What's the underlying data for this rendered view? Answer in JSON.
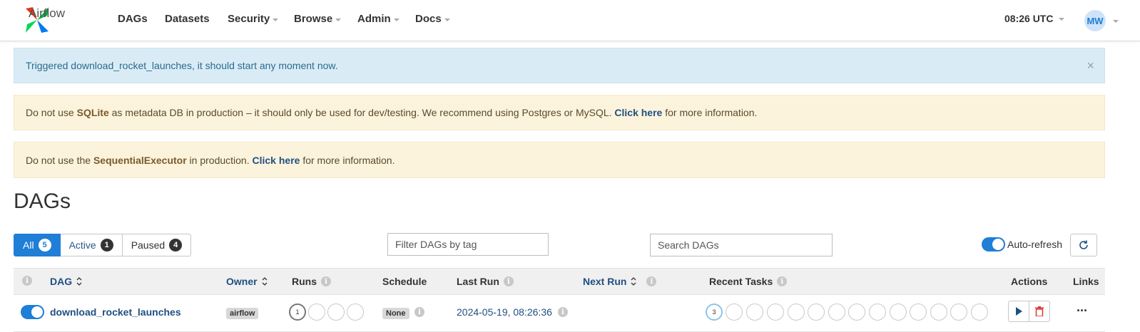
{
  "nav": {
    "brand": "Airflow",
    "items": [
      {
        "label": "DAGs"
      },
      {
        "label": "Datasets"
      },
      {
        "label": "Security"
      },
      {
        "label": "Browse"
      },
      {
        "label": "Admin"
      },
      {
        "label": "Docs"
      }
    ],
    "clock": "08:26 UTC",
    "user_initials": "MW"
  },
  "alerts": {
    "info": "Triggered download_rocket_launches, it should start any moment now.",
    "close": "×",
    "sqlite": {
      "pre": "Do not use ",
      "bold": "SQLite",
      "mid": " as metadata DB in production – it should only be used for dev/testing. We recommend using Postgres or MySQL. ",
      "link": "Click here",
      "post": " for more information."
    },
    "executor": {
      "pre": "Do not use the ",
      "bold": "SequentialExecutor",
      "mid": " in production. ",
      "link": "Click here",
      "post": " for more information."
    }
  },
  "page_title": "DAGs",
  "filters": [
    {
      "label": "All",
      "count": "5"
    },
    {
      "label": "Active",
      "count": "1"
    },
    {
      "label": "Paused",
      "count": "4"
    }
  ],
  "tag_filter": {
    "placeholder": "Filter DAGs by tag"
  },
  "search": {
    "placeholder": "Search DAGs"
  },
  "auto_refresh": {
    "label": "Auto-refresh",
    "enabled": true
  },
  "table": {
    "headers": {
      "dag": "DAG",
      "owner": "Owner",
      "runs": "Runs",
      "schedule": "Schedule",
      "last_run": "Last Run",
      "next_run": "Next Run",
      "recent_tasks": "Recent Tasks",
      "actions": "Actions",
      "links": "Links"
    },
    "rows": [
      {
        "dag": "download_rocket_launches",
        "owner": "airflow",
        "runs_count": "1",
        "schedule": "None",
        "last_run": "2024-05-19, 08:26:36",
        "recent_tasks_count": "3",
        "more": "···"
      }
    ]
  },
  "colors": {
    "accent": "#1f7ed6",
    "info_bg": "#d9ecf5",
    "warn_bg": "#fcf3dc"
  }
}
